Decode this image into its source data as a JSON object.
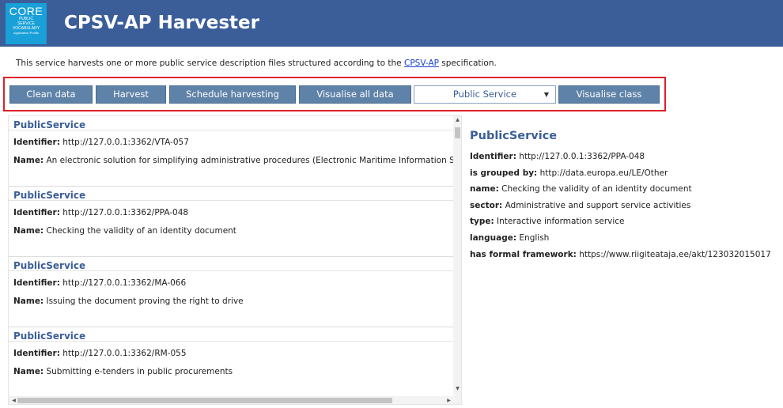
{
  "header": {
    "logo_big": "CORE",
    "logo_line1": "PUBLIC",
    "logo_line2": "SERVICE",
    "logo_line3": "VOCABULARY",
    "logo_line4": "Application Profile",
    "title": "CPSV-AP Harvester"
  },
  "intro": {
    "before": "This service harvests one or more public service description files structured according to the ",
    "link": "CPSV-AP",
    "after": " specification."
  },
  "toolbar": {
    "clean_label": "Clean data",
    "harvest_label": "Harvest",
    "schedule_label": "Schedule harvesting",
    "visualise_all_label": "Visualise all data",
    "class_select_value": "Public Service",
    "visualise_class_label": "Visualise class"
  },
  "list": {
    "identifier_label": "Identifier:",
    "name_label": "Name:",
    "entries": [
      {
        "title": "PublicService",
        "identifier": "http://127.0.0.1:3362/VTA-057",
        "name": "An electronic solution for simplifying administrative procedures (Electronic Maritime Information System)"
      },
      {
        "title": "PublicService",
        "identifier": "http://127.0.0.1:3362/PPA-048",
        "name": "Checking the validity of an identity document"
      },
      {
        "title": "PublicService",
        "identifier": "http://127.0.0.1:3362/MA-066",
        "name": "Issuing the document proving the right to drive"
      },
      {
        "title": "PublicService",
        "identifier": "http://127.0.0.1:3362/RM-055",
        "name": "Submitting e-tenders in public procurements"
      }
    ]
  },
  "detail": {
    "title": "PublicService",
    "rows": [
      {
        "label": "Identifier:",
        "value": "http://127.0.0.1:3362/PPA-048"
      },
      {
        "label": "is grouped by:",
        "value": "http://data.europa.eu/LE/Other"
      },
      {
        "label": "name:",
        "value": "Checking the validity of an identity document"
      },
      {
        "label": "sector:",
        "value": "Administrative and support service activities"
      },
      {
        "label": "type:",
        "value": "Interactive information service"
      },
      {
        "label": "language:",
        "value": "English"
      },
      {
        "label": "has formal framework:",
        "value": "https://www.riigiteataja.ee/akt/123032015017"
      }
    ]
  }
}
